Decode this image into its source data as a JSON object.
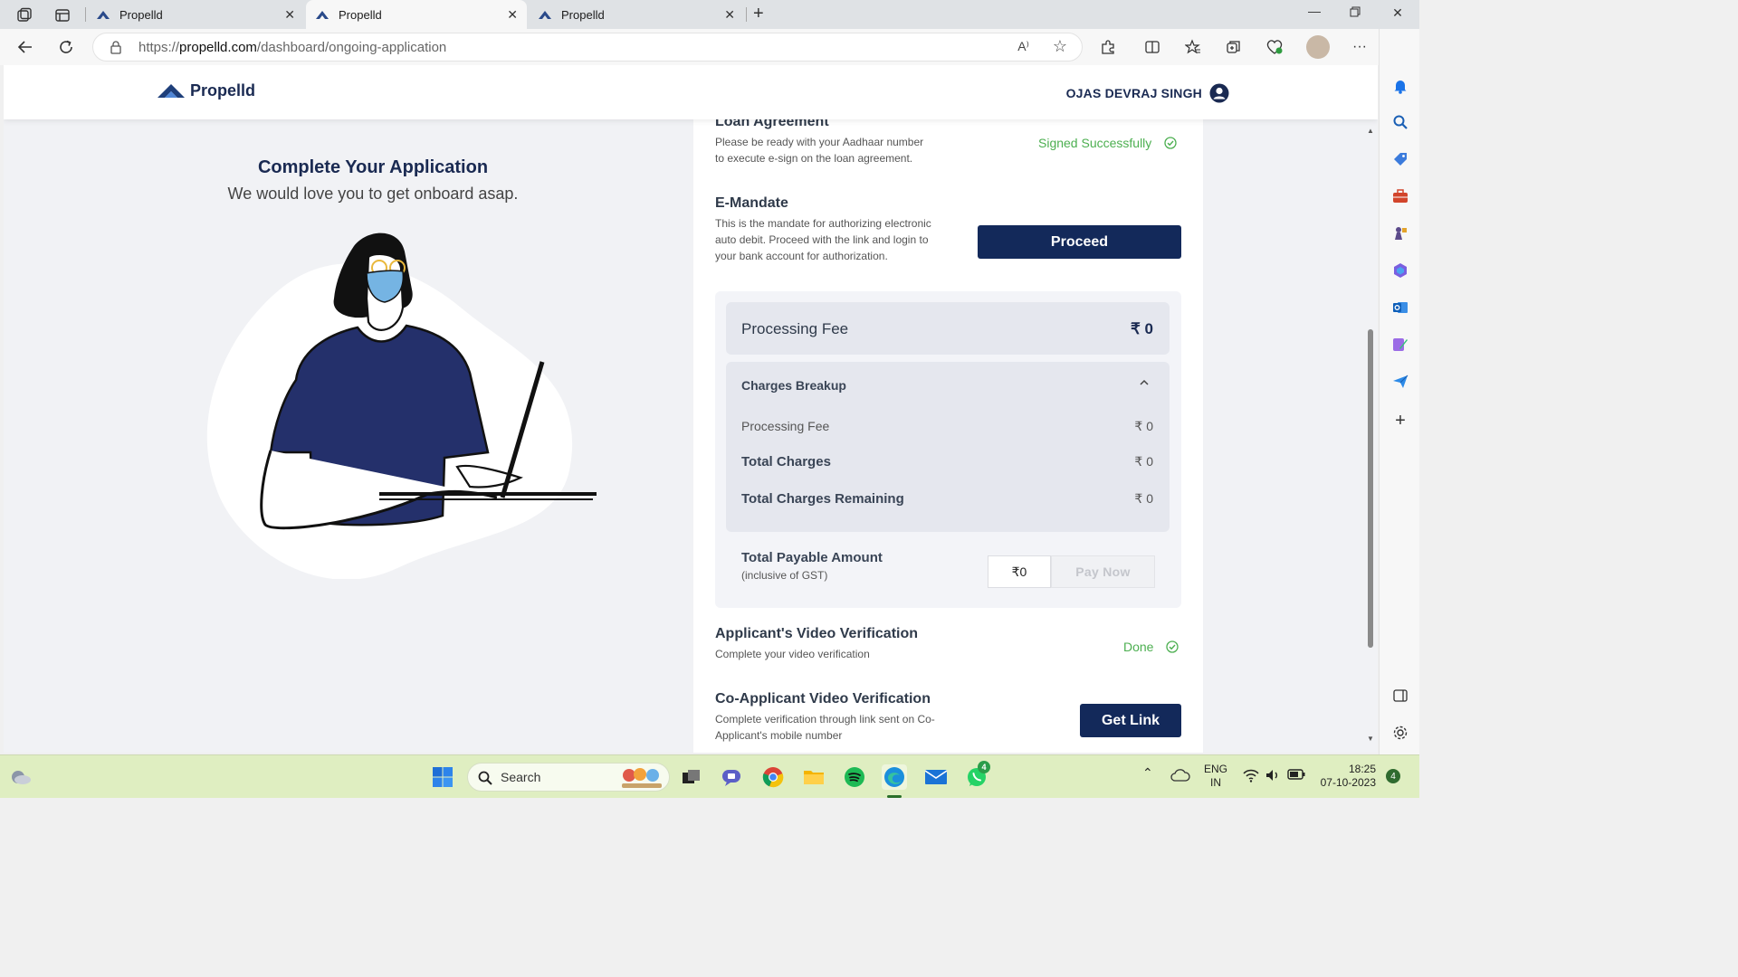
{
  "browser": {
    "tabs": [
      {
        "title": "Propelld",
        "active": false
      },
      {
        "title": "Propelld",
        "active": true
      },
      {
        "title": "Propelld",
        "active": false
      }
    ],
    "url_prefix": "https://",
    "url_domain": "propelld.com",
    "url_path": "/dashboard/ongoing-application",
    "read_aloud": "A⁾"
  },
  "site": {
    "brand": "Propelld",
    "user_name": "OJAS DEVRAJ SINGH"
  },
  "left": {
    "title": "Complete Your Application",
    "subtitle": "We would love you to get onboard asap."
  },
  "loan_agreement": {
    "title": "Loan Agreement",
    "desc": "Please be ready with your Aadhaar number to execute e-sign on the loan agreement.",
    "status": "Signed Successfully"
  },
  "emandate": {
    "title": "E-Mandate",
    "desc": "This is the mandate for authorizing electronic auto debit. Proceed with the link and login to your bank account for authorization.",
    "button": "Proceed"
  },
  "fees": {
    "processing_fee_label": "Processing Fee",
    "processing_fee_value": "₹ 0",
    "breakup_title": "Charges Breakup",
    "rows": [
      {
        "label": "Processing Fee",
        "value": "₹ 0"
      },
      {
        "label": "Total Charges",
        "value": "₹ 0"
      },
      {
        "label": "Total Charges Remaining",
        "value": "₹ 0"
      }
    ],
    "total_payable_label": "Total Payable Amount",
    "total_payable_note": "(inclusive of GST)",
    "amount": "₹0",
    "pay_button": "Pay Now"
  },
  "video": {
    "title": "Applicant's Video Verification",
    "desc": "Complete your video verification",
    "status": "Done"
  },
  "co_video": {
    "title": "Co-Applicant Video Verification",
    "desc": "Complete verification through link sent on Co-Applicant's mobile number",
    "button": "Get Link"
  },
  "taskbar": {
    "search_label": "Search",
    "lang_1": "ENG",
    "lang_2": "IN",
    "time": "18:25",
    "date": "07-10-2023",
    "whatsapp_badge": "4",
    "notif_count": "4"
  },
  "colors": {
    "navy": "#13295a",
    "success": "#4caf50",
    "taskbar": "#dfeec1"
  }
}
